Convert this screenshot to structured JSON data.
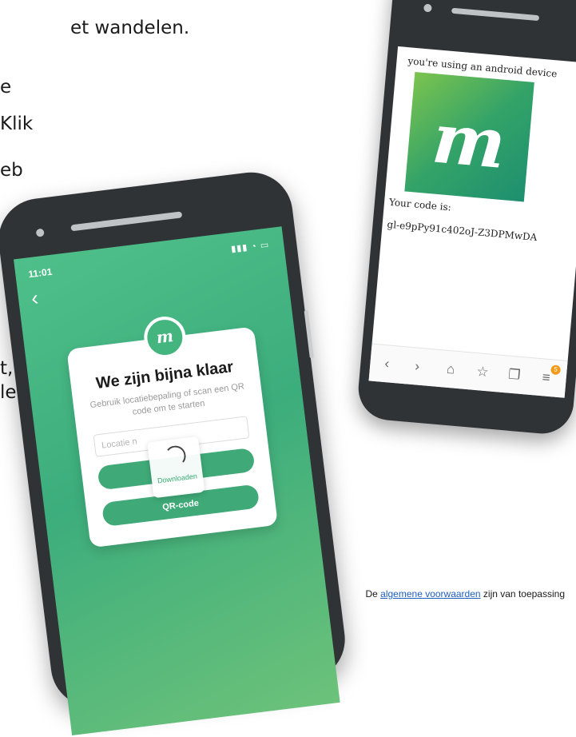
{
  "document": {
    "lines": [
      "et wandelen.",
      "e",
      "Klik",
      "eb",
      "t,",
      "le"
    ]
  },
  "phone_android": {
    "info": "you're using an android device",
    "logo_letter": "m",
    "code_label": "Your code is:",
    "code": "gl-e9pPy91c402oJ-Z3DPMwDA",
    "nav_icons": [
      "chevron-left-icon",
      "chevron-right-icon",
      "home-icon",
      "star-icon",
      "tabs-icon",
      "menu-icon"
    ],
    "nav_badge": "5"
  },
  "phone_ios": {
    "time": "11:01",
    "status_icons": [
      "signal-icon",
      "wifi-icon",
      "battery-icon"
    ],
    "logo_letter": "m",
    "title": "We zijn bijna klaar",
    "subtitle": "Gebruik locatiebepaling of scan een QR code om te starten",
    "location_placeholder": "Locatie n",
    "loader_text": "Downloaden",
    "qr_button": "QR-code"
  },
  "footer": {
    "prefix": "De",
    "link": "algemene voorwaarden",
    "suffix": "zijn van toepassing"
  }
}
